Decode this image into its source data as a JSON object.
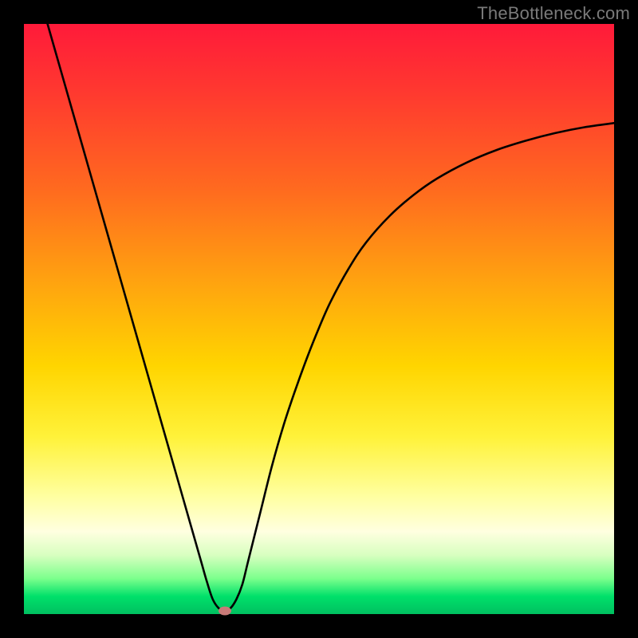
{
  "attribution": "TheBottleneck.com",
  "colors": {
    "frame": "#000000",
    "curve": "#000000",
    "marker": "#c97a78",
    "gradient_top": "#ff1a3a",
    "gradient_bottom": "#00c060"
  },
  "chart_data": {
    "type": "line",
    "title": "",
    "xlabel": "",
    "ylabel": "",
    "xlim": [
      0,
      100
    ],
    "ylim": [
      0,
      100
    ],
    "grid": false,
    "legend": false,
    "series": [
      {
        "name": "bottleneck-curve",
        "x": [
          4,
          6,
          8,
          10,
          12,
          14,
          16,
          18,
          20,
          22,
          24,
          26,
          28,
          30,
          31,
          32,
          33,
          34,
          35,
          36,
          37,
          38,
          40,
          42,
          44,
          46,
          48,
          50,
          52,
          55,
          58,
          62,
          66,
          70,
          75,
          80,
          85,
          90,
          95,
          100
        ],
        "values": [
          100,
          93,
          86,
          79,
          72,
          65,
          58,
          51,
          44,
          37,
          30,
          23,
          16,
          9,
          5.5,
          2.5,
          1,
          0.5,
          1,
          2.5,
          5,
          9,
          17,
          25,
          32,
          38,
          43.5,
          48.5,
          53,
          58.5,
          63,
          67.5,
          71,
          73.8,
          76.5,
          78.6,
          80.2,
          81.5,
          82.5,
          83.2
        ]
      }
    ],
    "optimal_marker": {
      "x": 34,
      "y": 0.5
    },
    "annotations": []
  }
}
